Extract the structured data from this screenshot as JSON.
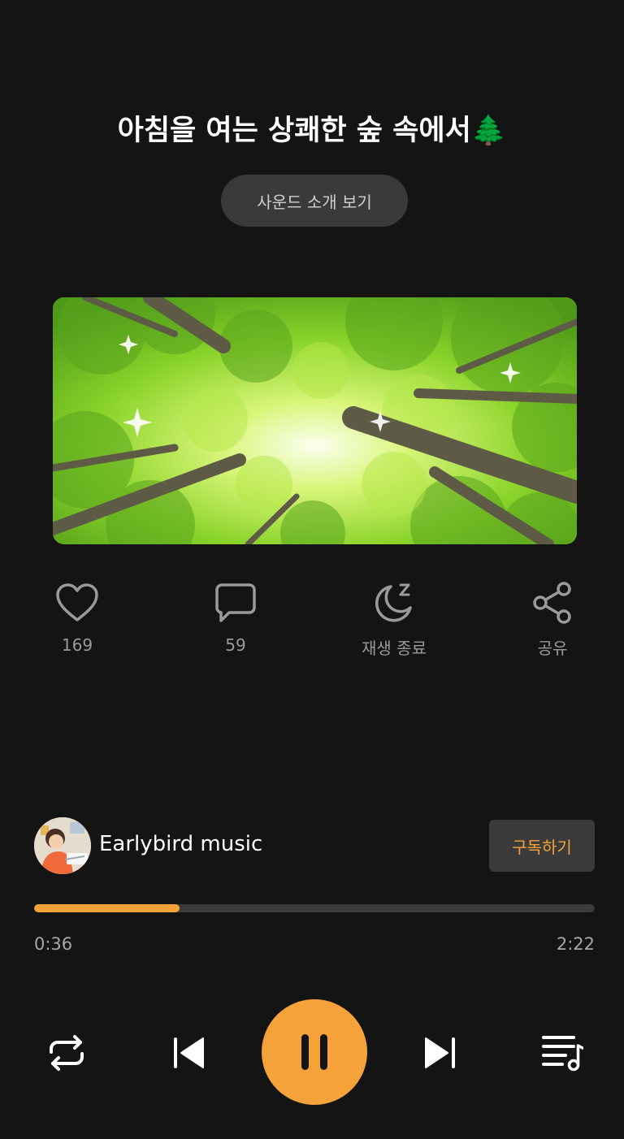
{
  "header": {
    "title": "아침을 여는 상쾌한 숲 속에서",
    "title_emoji": "🌲",
    "intro_button": "사운드 소개 보기"
  },
  "cover": {
    "image": "forest-canopy-cover"
  },
  "actions": [
    {
      "icon": "heart-icon",
      "label": "169"
    },
    {
      "icon": "comment-icon",
      "label": "59"
    },
    {
      "icon": "sleep-timer-icon",
      "label": "재생 종료"
    },
    {
      "icon": "share-icon",
      "label": "공유"
    }
  ],
  "channel": {
    "name": "Earlybird music",
    "subscribe_label": "구독하기"
  },
  "player": {
    "current_time": "0:36",
    "total_time": "2:22",
    "progress": 0.259
  },
  "controls": [
    "repeat-icon",
    "previous-icon",
    "pause-icon",
    "next-icon",
    "playlist-icon"
  ],
  "colors": {
    "accent": "#f5a23a",
    "background": "#141414",
    "muted_text": "#9a9a9a",
    "button_bg": "#3a3a3a"
  }
}
